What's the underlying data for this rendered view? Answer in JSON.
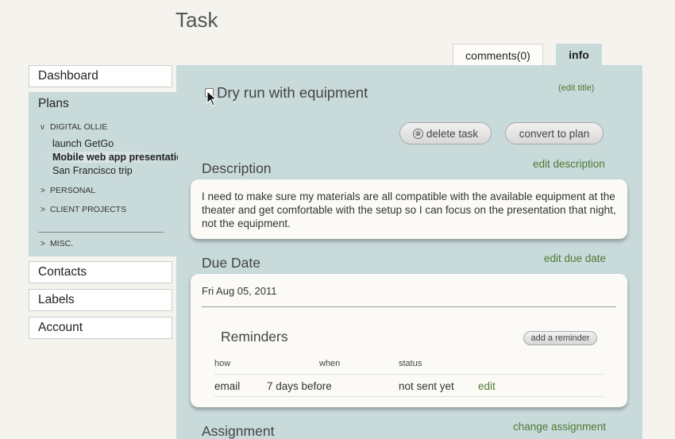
{
  "page": {
    "title": "Task"
  },
  "tabs": {
    "comments": "comments(0)",
    "info": "info"
  },
  "sidebar": {
    "dashboard": "Dashboard",
    "plans": {
      "label": "Plans",
      "groups": [
        {
          "arrow": "v",
          "label": "DIGITAL OLLIE"
        },
        {
          "arrow": ">",
          "label": "PERSONAL"
        },
        {
          "arrow": ">",
          "label": "CLIENT PROJECTS"
        },
        {
          "arrow": ">",
          "label": "MISC."
        }
      ],
      "items": [
        "launch GetGo",
        "Mobile web app presentation",
        "San Francisco trip"
      ]
    },
    "contacts": "Contacts",
    "labels": "Labels",
    "account": "Account"
  },
  "task": {
    "title": "Dry run with equipment",
    "edit_title": "(edit title)",
    "delete_label": "delete task",
    "delete_icon": "⊗",
    "convert_label": "convert to plan"
  },
  "description": {
    "heading": "Description",
    "edit_label": "edit description",
    "text": "I need to make sure my materials are all compatible with the available equipment at the theater and get comfortable with the setup so I can focus on the presentation that night, not the equipment."
  },
  "due": {
    "heading": "Due Date",
    "edit_label": "edit due date",
    "date": "Fri Aug 05, 2011"
  },
  "reminders": {
    "heading": "Reminders",
    "add_label": "add a reminder",
    "headers": {
      "how": "how",
      "when": "when",
      "status": "status"
    },
    "rows": [
      {
        "how": "email",
        "when": "7 days before",
        "status": "not sent yet",
        "action": "edit"
      }
    ]
  },
  "assignment": {
    "heading": "Assignment",
    "edit_label": "change assignment"
  },
  "colors": {
    "panel": "#c9dadb",
    "link": "#4d7a33",
    "background": "#f5f3ee"
  },
  "icons": {
    "pointer": "cursor-arrow-icon"
  }
}
